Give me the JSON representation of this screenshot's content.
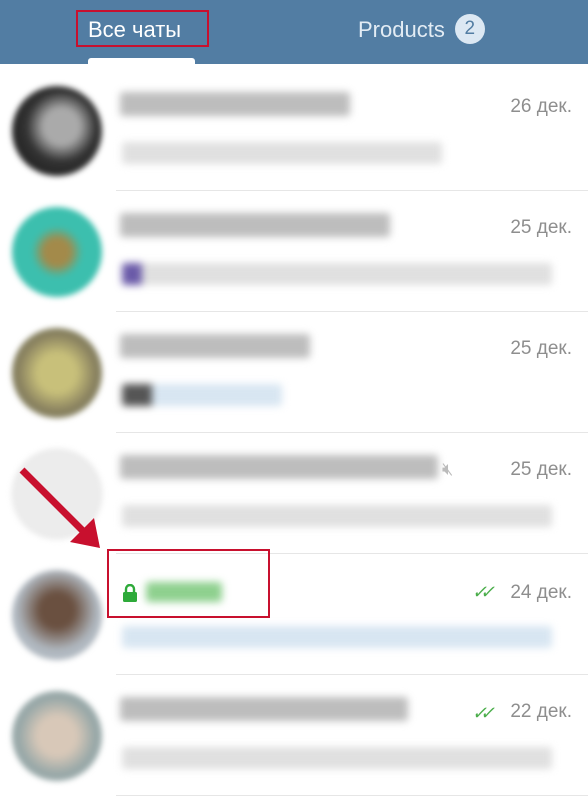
{
  "header": {
    "tabs": [
      {
        "label": "Все чаты",
        "active": true
      },
      {
        "label": "Products",
        "badge": "2"
      }
    ]
  },
  "chats": [
    {
      "date": "26 дек.",
      "avatar_color": "#3a3a3a",
      "muted": false,
      "read": false
    },
    {
      "date": "25 дек.",
      "avatar_color": "#3cbfae",
      "muted": false,
      "read": false
    },
    {
      "date": "25 дек.",
      "avatar_color": "#b8b070",
      "muted": false,
      "read": false
    },
    {
      "date": "25 дек.",
      "avatar_color": "#ececec",
      "muted": true,
      "read": false
    },
    {
      "date": "24 дек.",
      "avatar_color": "#8a7a70",
      "secret": true,
      "read": true
    },
    {
      "date": "22 дек.",
      "avatar_color": "#a8b4b0",
      "muted": false,
      "read": true
    }
  ],
  "colors": {
    "header": "#527da3",
    "highlight": "#c8102e",
    "secret": "#2eaa3a"
  }
}
